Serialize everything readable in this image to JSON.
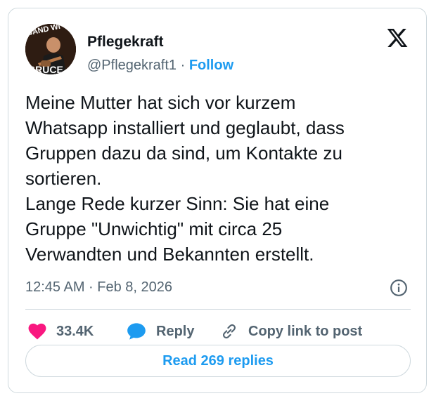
{
  "tweet": {
    "author_name": "Pflegekraft",
    "handle": "@Pflegekraft1",
    "separator": " · ",
    "follow_label": "Follow",
    "avatar_text_top": "BAND WI",
    "avatar_text_bottom": "BRUCE",
    "text": "Meine Mutter hat sich vor kurzem\nWhatsapp installiert und geglaubt, dass\nGruppen dazu da sind, um Kontakte zu\nsortieren.\nLange Rede kurzer Sinn: Sie hat eine\nGruppe \"Unwichtig\" mit circa 25\nVerwandten und Bekannten erstellt.",
    "timestamp": "12:45 AM · Feb 8, 2026"
  },
  "actions": {
    "like_count": "33.4K",
    "reply_label": "Reply",
    "copy_label": "Copy link to post"
  },
  "read_replies_label": "Read 269 replies",
  "icons": {
    "logo": "x-logo-icon",
    "info": "info-icon",
    "like": "heart-icon",
    "reply": "speech-bubble-icon",
    "copy": "link-icon"
  },
  "colors": {
    "accent": "#1d9bf0",
    "heart": "#f91880",
    "text": "#0f1419",
    "secondary": "#536471",
    "border": "#cfd9de"
  }
}
